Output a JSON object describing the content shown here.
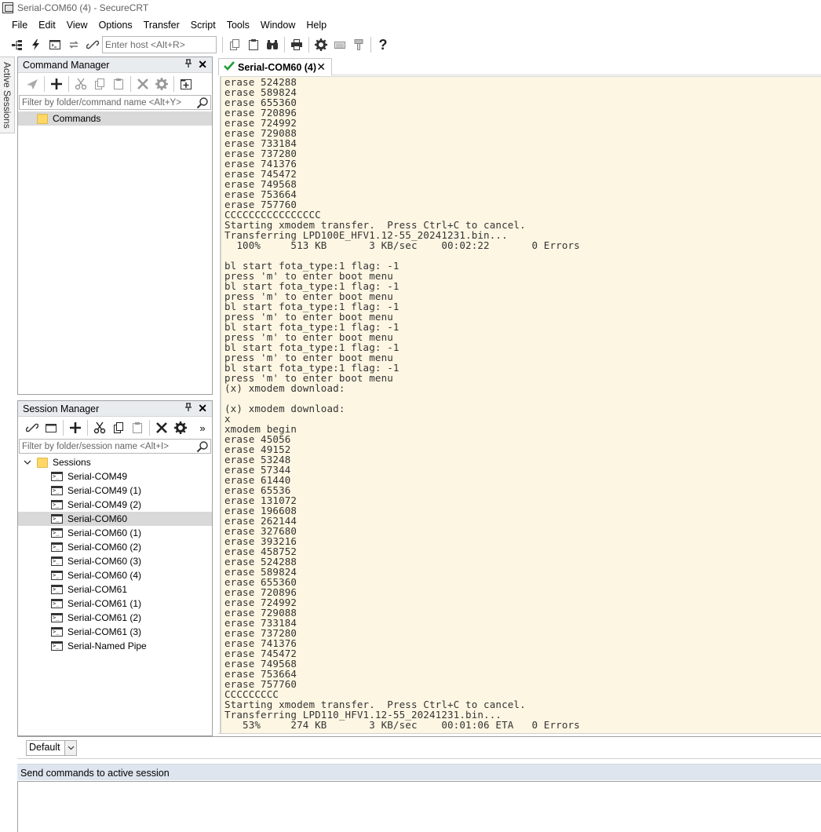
{
  "window": {
    "title": "Serial-COM60 (4) - SecureCRT"
  },
  "menu": [
    "File",
    "Edit",
    "View",
    "Options",
    "Transfer",
    "Script",
    "Tools",
    "Window",
    "Help"
  ],
  "toolbar": {
    "host_placeholder": "Enter host <Alt+R>"
  },
  "sidebar_tab": {
    "label": "Active Sessions"
  },
  "command_manager": {
    "title": "Command Manager",
    "pin": "⭿",
    "filter_placeholder": "Filter by folder/command name <Alt+Y>",
    "tree": [
      {
        "label": "Commands",
        "selected": true
      }
    ]
  },
  "session_manager": {
    "title": "Session Manager",
    "filter_placeholder": "Filter by folder/session name <Alt+I>",
    "root": "Sessions",
    "sessions": [
      "Serial-COM49",
      "Serial-COM49 (1)",
      "Serial-COM49 (2)",
      "Serial-COM60",
      "Serial-COM60 (1)",
      "Serial-COM60 (2)",
      "Serial-COM60 (3)",
      "Serial-COM60 (4)",
      "Serial-COM61",
      "Serial-COM61 (1)",
      "Serial-COM61 (2)",
      "Serial-COM61 (3)",
      "Serial-Named Pipe"
    ],
    "selected_session": "Serial-COM60"
  },
  "tab": {
    "label": "Serial-COM60 (4)",
    "status_color": "#1e9e3a"
  },
  "terminal": {
    "background": "#fdf6e3",
    "lines": [
      "erase 524288",
      "erase 589824",
      "erase 655360",
      "erase 720896",
      "erase 724992",
      "erase 729088",
      "erase 733184",
      "erase 737280",
      "erase 741376",
      "erase 745472",
      "erase 749568",
      "erase 753664",
      "erase 757760",
      "CCCCCCCCCCCCCCCC",
      "Starting xmodem transfer.  Press Ctrl+C to cancel.",
      "Transferring LPD100E_HFV1.12-55_20241231.bin...",
      "  100%     513 KB       3 KB/sec    00:02:22       0 Errors",
      "",
      "bl start fota_type:1 flag: -1",
      "press 'm' to enter boot menu",
      "bl start fota_type:1 flag: -1",
      "press 'm' to enter boot menu",
      "bl start fota_type:1 flag: -1",
      "press 'm' to enter boot menu",
      "bl start fota_type:1 flag: -1",
      "press 'm' to enter boot menu",
      "bl start fota_type:1 flag: -1",
      "press 'm' to enter boot menu",
      "bl start fota_type:1 flag: -1",
      "press 'm' to enter boot menu",
      "(x) xmodem download:",
      "",
      "(x) xmodem download:",
      "x",
      "xmodem begin",
      "erase 45056",
      "erase 49152",
      "erase 53248",
      "erase 57344",
      "erase 61440",
      "erase 65536",
      "erase 131072",
      "erase 196608",
      "erase 262144",
      "erase 327680",
      "erase 393216",
      "erase 458752",
      "erase 524288",
      "erase 589824",
      "erase 655360",
      "erase 720896",
      "erase 724992",
      "erase 729088",
      "erase 733184",
      "erase 737280",
      "erase 741376",
      "erase 745472",
      "erase 749568",
      "erase 753664",
      "erase 757760",
      "CCCCCCCCC",
      "Starting xmodem transfer.  Press Ctrl+C to cancel.",
      "Transferring LPD110_HFV1.12-55_20241231.bin...",
      "   53%     274 KB       3 KB/sec    00:01:06 ETA   0 Errors"
    ]
  },
  "button_bar": {
    "selected": "Default"
  },
  "command_window": {
    "title": "Send commands to active session"
  }
}
